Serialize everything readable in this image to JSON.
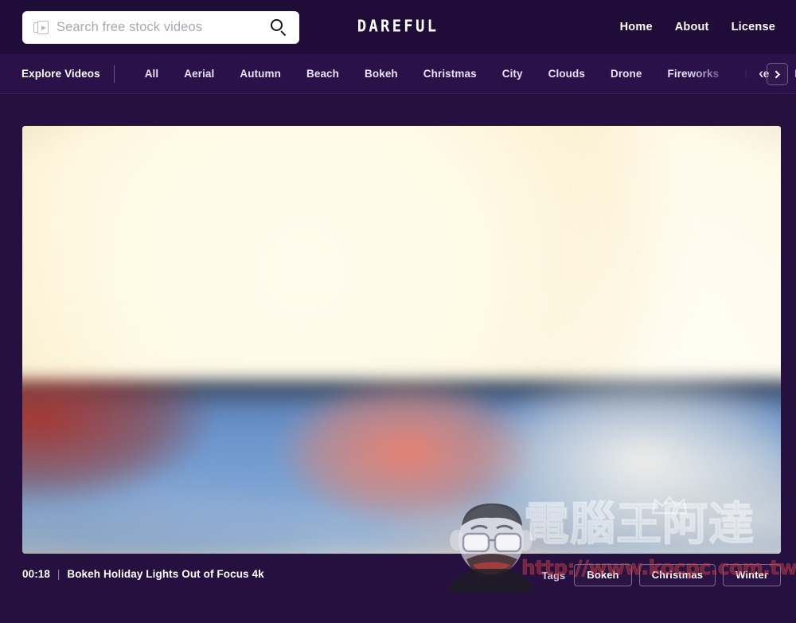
{
  "site": {
    "logo_text": "DAREFUL",
    "background_color": "#251040",
    "header_color": "#1f0c38",
    "catbar_color": "#2a1149"
  },
  "search": {
    "placeholder": "Search free stock videos",
    "value": "",
    "video_icon": "video-stack-icon",
    "submit_icon": "search-icon"
  },
  "top_nav": {
    "items": [
      {
        "label": "Home"
      },
      {
        "label": "About"
      },
      {
        "label": "License"
      }
    ]
  },
  "category_bar": {
    "explore_label": "Explore Videos",
    "next_icon": "chevron-right-icon",
    "items": [
      {
        "label": "All"
      },
      {
        "label": "Aerial"
      },
      {
        "label": "Autumn"
      },
      {
        "label": "Beach"
      },
      {
        "label": "Bokeh"
      },
      {
        "label": "Christmas"
      },
      {
        "label": "City"
      },
      {
        "label": "Clouds"
      },
      {
        "label": "Drone"
      },
      {
        "label": "Fireworks"
      },
      {
        "label": "Lake"
      },
      {
        "label": "Mountains"
      }
    ]
  },
  "video": {
    "duration": "00:18",
    "separator": "|",
    "title": "Bokeh Holiday Lights Out of Focus 4k",
    "alt": "Blurred out-of-focus golden bokeh holiday lights over a blue background"
  },
  "tags": {
    "label": "Tags",
    "items": [
      {
        "label": "Bokeh"
      },
      {
        "label": "Christmas"
      },
      {
        "label": "Winter"
      }
    ]
  },
  "watermark": {
    "text": "電腦王阿達",
    "url": "http://www.kocpc.com.tw"
  }
}
